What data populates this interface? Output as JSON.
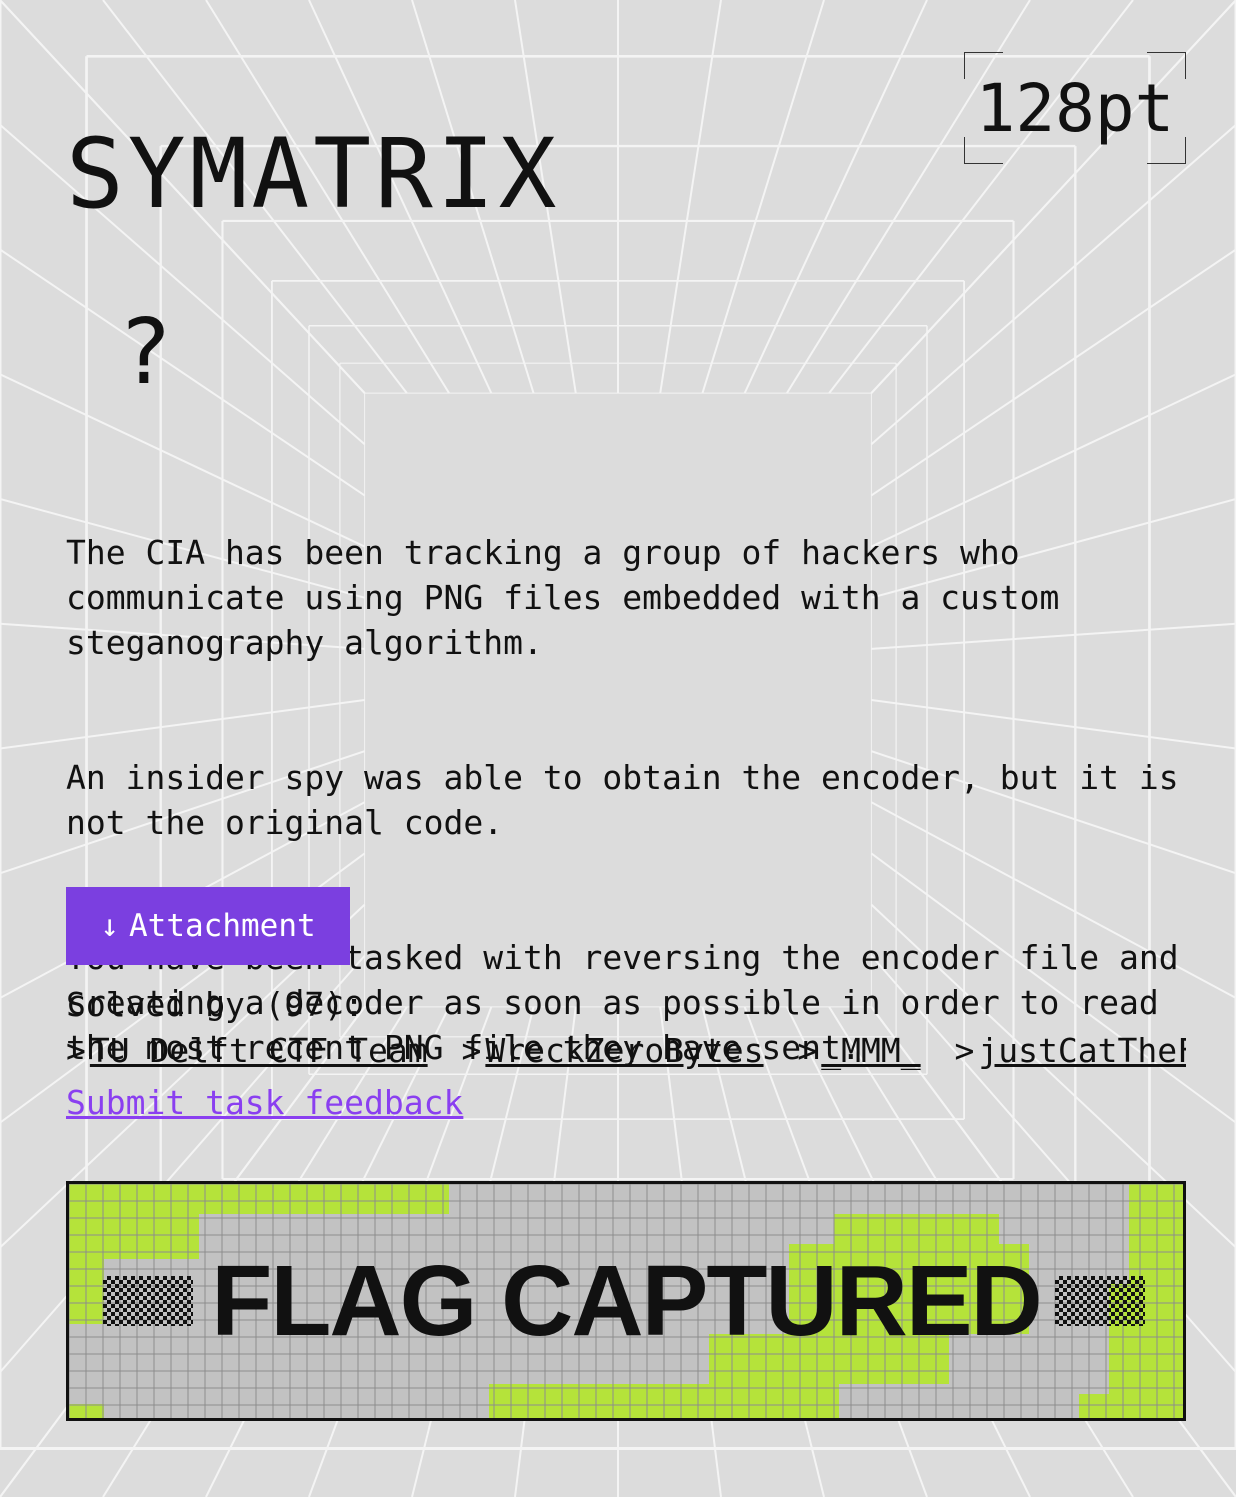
{
  "challenge": {
    "title": "SYMATRIX",
    "points": "128pt",
    "category_icon": "?",
    "description": [
      "The CIA has been tracking a group of hackers who communicate using PNG files embedded with a custom steganography algorithm.",
      "An insider spy was able to obtain the encoder, but it is not the original code.",
      "You have been tasked with reversing the encoder file and creating a decoder as soon as possible in order to read the most recent PNG file they have sent."
    ]
  },
  "attachment": {
    "icon": "↓",
    "label": "Attachment"
  },
  "solved": {
    "label": "Solved by (97):"
  },
  "solvers": [
    "TU Delft CTF Team",
    "WreckZeroBytes",
    "_MMM_",
    "justCatTheFish"
  ],
  "feedback": {
    "label": "Submit task feedback"
  },
  "banner": {
    "text": "FLAG CAPTURED"
  },
  "colors": {
    "accent": "#7b3fe0",
    "link": "#8a3ff0",
    "banner_green": "#b5e33a",
    "banner_grey": "#c2c2c2"
  }
}
